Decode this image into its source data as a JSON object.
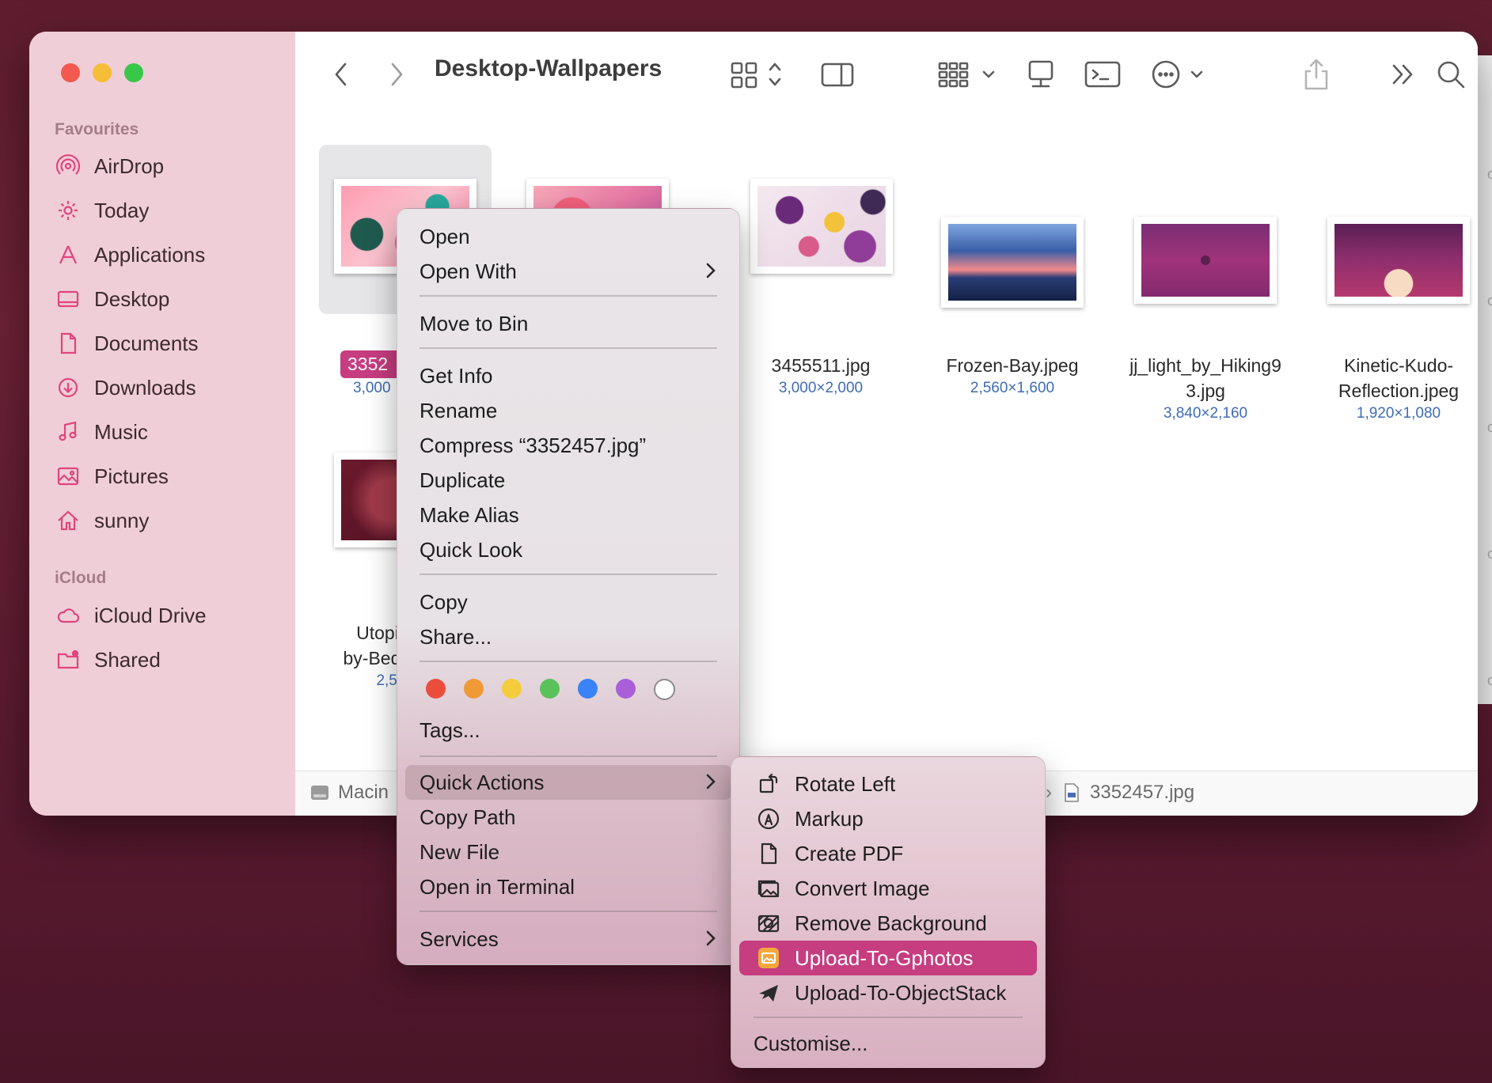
{
  "window": {
    "title": "Desktop-Wallpapers"
  },
  "sidebar": {
    "favourites_label": "Favourites",
    "favourites": [
      {
        "label": "AirDrop",
        "icon": "airdrop-icon"
      },
      {
        "label": "Today",
        "icon": "gear-icon"
      },
      {
        "label": "Applications",
        "icon": "applications-icon"
      },
      {
        "label": "Desktop",
        "icon": "desktop-icon"
      },
      {
        "label": "Documents",
        "icon": "document-icon"
      },
      {
        "label": "Downloads",
        "icon": "download-icon"
      },
      {
        "label": "Music",
        "icon": "music-icon"
      },
      {
        "label": "Pictures",
        "icon": "pictures-icon"
      },
      {
        "label": "sunny",
        "icon": "home-icon"
      }
    ],
    "icloud_label": "iCloud",
    "icloud": [
      {
        "label": "iCloud Drive",
        "icon": "cloud-icon"
      },
      {
        "label": "Shared",
        "icon": "shared-folder-icon"
      }
    ]
  },
  "files": [
    {
      "name": "3352457.jpg",
      "name_visible": "3352",
      "dims_visible": "3,000",
      "selected": true
    },
    {
      "name": "",
      "dims_visible": ""
    },
    {
      "name_visible": "3455511.jpg",
      "dims_visible": "3,000×2,000"
    },
    {
      "name_visible": "Frozen-Bay.jpeg",
      "dims_visible": "2,560×1,600"
    },
    {
      "name_line1": "jj_light_by_Hiking9",
      "name_line2": "3.jpg",
      "dims_visible": "3,840×2,160"
    },
    {
      "name_line1": "Kinetic-Kudo-",
      "name_line2": "Reflection.jpeg",
      "dims_visible": "1,920×1,080"
    },
    {
      "name_line1": "Utopic-",
      "name_line2": "by-Bedis",
      "dims_visible": "2,560"
    }
  ],
  "pathbar": {
    "start": "Macin",
    "end": "3352457.jpg"
  },
  "context_menu": {
    "open": "Open",
    "open_with": "Open With",
    "move_to_bin": "Move to Bin",
    "get_info": "Get Info",
    "rename": "Rename",
    "compress": "Compress “3352457.jpg”",
    "duplicate": "Duplicate",
    "make_alias": "Make Alias",
    "quick_look": "Quick Look",
    "copy": "Copy",
    "share": "Share...",
    "tag_colors": [
      "#eb4d3d",
      "#f09a37",
      "#f5cd3c",
      "#5ac25a",
      "#3a82f7",
      "#a95fd8",
      "#ffffff"
    ],
    "tags": "Tags...",
    "quick_actions": "Quick Actions",
    "copy_path": "Copy Path",
    "new_file": "New File",
    "open_in_terminal": "Open in Terminal",
    "services": "Services"
  },
  "quick_actions_submenu": {
    "items": [
      {
        "label": "Rotate Left",
        "icon": "rotate-left-icon"
      },
      {
        "label": "Markup",
        "icon": "markup-icon"
      },
      {
        "label": "Create PDF",
        "icon": "create-pdf-icon"
      },
      {
        "label": "Convert Image",
        "icon": "convert-image-icon"
      },
      {
        "label": "Remove Background",
        "icon": "remove-background-icon"
      },
      {
        "label": "Upload-To-Gphotos",
        "icon": "gphotos-icon",
        "highlighted": true
      },
      {
        "label": "Upload-To-ObjectStack",
        "icon": "paper-plane-icon"
      }
    ],
    "customise": "Customise..."
  },
  "colors": {
    "accent": "#c63d80",
    "sidebar_bg": "#f0ced8",
    "dim_text": "#3e6cb5"
  }
}
